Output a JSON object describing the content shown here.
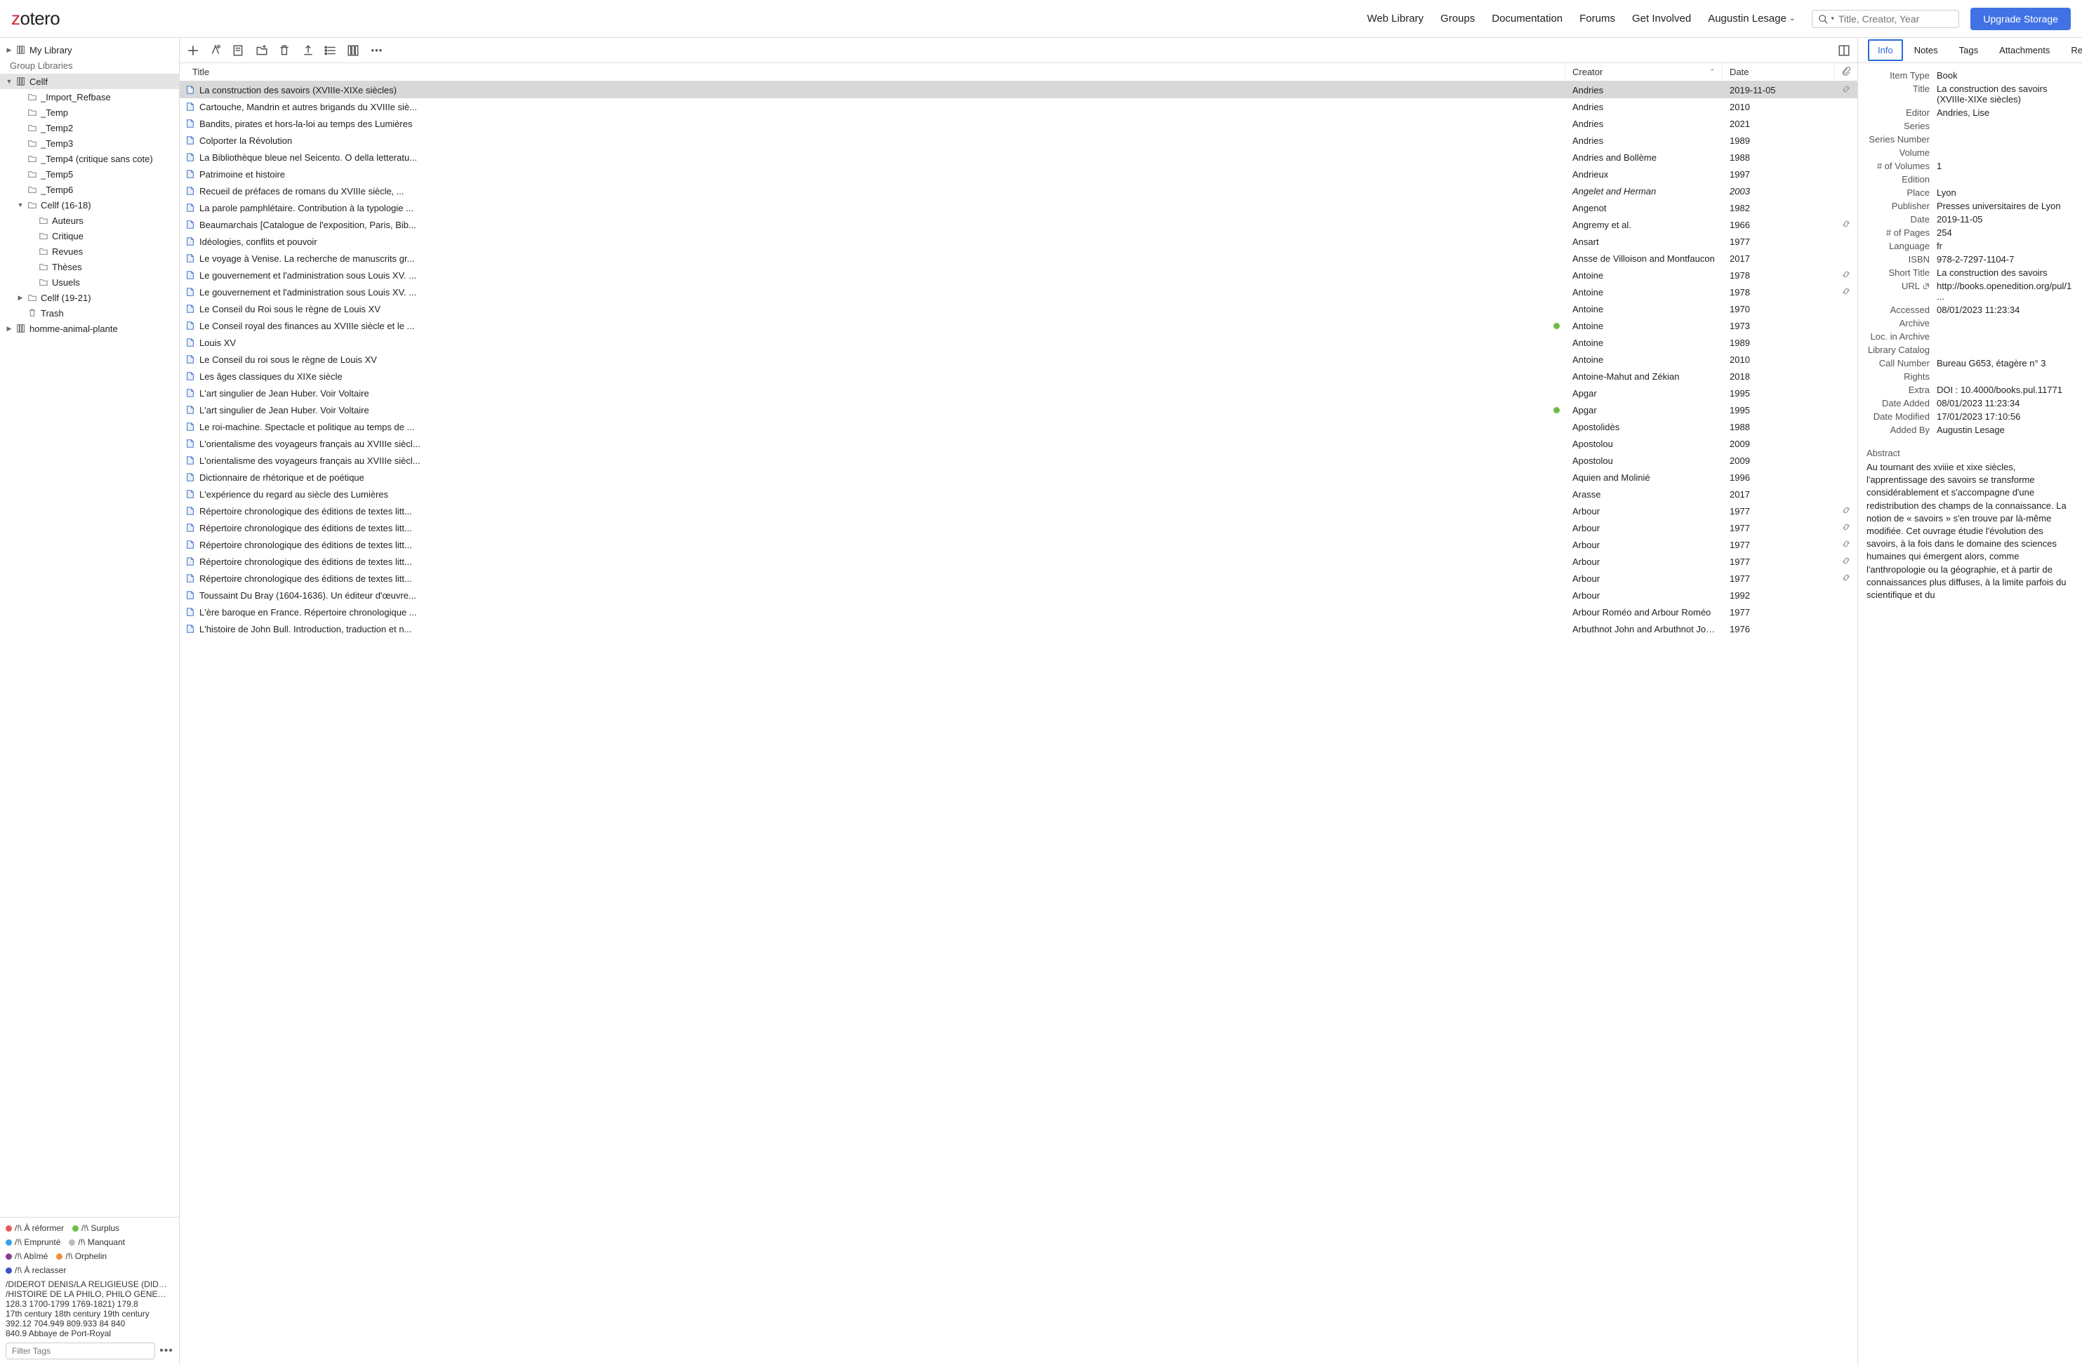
{
  "header": {
    "logo_z": "z",
    "logo_rest": "otero",
    "nav": [
      "Web Library",
      "Groups",
      "Documentation",
      "Forums",
      "Get Involved"
    ],
    "user": "Augustin Lesage",
    "search_placeholder": "Title, Creator, Year",
    "upgrade": "Upgrade Storage"
  },
  "sidebar": {
    "my_library": "My Library",
    "group_header": "Group Libraries",
    "groups": [
      {
        "label": "Cellf",
        "selected": true,
        "children": [
          {
            "label": "_Import_Refbase"
          },
          {
            "label": "_Temp"
          },
          {
            "label": "_Temp2"
          },
          {
            "label": "_Temp3"
          },
          {
            "label": "_Temp4 (critique sans cote)"
          },
          {
            "label": "_Temp5"
          },
          {
            "label": "_Temp6"
          },
          {
            "label": "Cellf (16-18)",
            "expandable": true,
            "open": true,
            "children": [
              {
                "label": "Auteurs"
              },
              {
                "label": "Critique"
              },
              {
                "label": "Revues"
              },
              {
                "label": "Thèses"
              },
              {
                "label": "Usuels"
              }
            ]
          },
          {
            "label": "Cellf (19-21)",
            "expandable": true,
            "open": false
          },
          {
            "label": "Trash",
            "trash": true
          }
        ]
      },
      {
        "label": "homme-animal-plante",
        "expandable": true,
        "open": false
      }
    ]
  },
  "tags": {
    "colored": [
      {
        "color": "#e85a5a",
        "label": "/!\\ À réformer"
      },
      {
        "color": "#6dbd45",
        "label": "/!\\ Surplus"
      },
      {
        "color": "#3aa0e8",
        "label": "/!\\ Emprunté"
      },
      {
        "color": "#bbbbbb",
        "label": "/!\\ Manquant"
      },
      {
        "color": "#8a3c8f",
        "label": "/!\\ Abîmé"
      },
      {
        "color": "#e8923a",
        "label": "/!\\ Orphelin"
      },
      {
        "color": "#3c50c9",
        "label": "/!\\ À reclasser"
      }
    ],
    "plain": [
      "/DIDEROT DENIS/LA RELIGIEUSE (DIDERO...",
      "/HISTOIRE DE LA PHILO, PHILO GENERAL...",
      "128.3   1700-1799   1769-1821)   179.8",
      "17th century   18th century   19th century",
      "392.12   704.949   809.933 84   840",
      "840.9   Abbaye de Port-Royal"
    ],
    "filter_placeholder": "Filter Tags"
  },
  "columns": {
    "title": "Title",
    "creator": "Creator",
    "date": "Date"
  },
  "items": [
    {
      "title": "La construction des savoirs (XVIIIe-XIXe siècles)",
      "creator": "Andries",
      "date": "2019-11-05",
      "attach": true,
      "selected": true
    },
    {
      "title": "Cartouche, Mandrin et autres brigands du XVIIIe siè...",
      "creator": "Andries",
      "date": "2010"
    },
    {
      "title": "Bandits, pirates et hors-la-loi au temps des Lumières",
      "creator": "Andries",
      "date": "2021"
    },
    {
      "title": "Colporter la Révolution",
      "creator": "Andries",
      "date": "1989"
    },
    {
      "title": "La Bibliothèque bleue nel Seicento. O della letteratu...",
      "creator": "Andries and Bollème",
      "date": "1988"
    },
    {
      "title": "Patrimoine et histoire",
      "creator": "Andrieux",
      "date": "1997"
    },
    {
      "title": "Recueil de préfaces de romans du XVIIIe siècle<i>, ...",
      "creator": "Angelet and Herman",
      "date": "2003"
    },
    {
      "title": "La parole pamphlétaire. Contribution à la typologie ...",
      "creator": "Angenot",
      "date": "1982"
    },
    {
      "title": "Beaumarchais [Catalogue de l'exposition, Paris, Bib...",
      "creator": "Angremy et al.",
      "date": "1966",
      "attach": true
    },
    {
      "title": "Idéologies, conflits et pouvoir",
      "creator": "Ansart",
      "date": "1977"
    },
    {
      "title": "Le voyage à Venise. La recherche de manuscrits gr...",
      "creator": "Ansse de Villoison and Montfaucon",
      "date": "2017"
    },
    {
      "title": "Le gouvernement et l'administration sous Louis XV. ...",
      "creator": "Antoine",
      "date": "1978",
      "attach": true
    },
    {
      "title": "Le gouvernement et l'administration sous Louis XV. ...",
      "creator": "Antoine",
      "date": "1978",
      "attach": true
    },
    {
      "title": "Le Conseil du Roi sous le règne de Louis XV",
      "creator": "Antoine",
      "date": "1970"
    },
    {
      "title": "Le Conseil royal des finances au XVIIIe siècle et le ...",
      "creator": "Antoine",
      "date": "1973",
      "dot": "#6dbd45"
    },
    {
      "title": "Louis XV",
      "creator": "Antoine",
      "date": "1989"
    },
    {
      "title": "Le Conseil du roi sous le règne de Louis XV",
      "creator": "Antoine",
      "date": "2010"
    },
    {
      "title": "Les âges classiques du XIXe siècle",
      "creator": "Antoine-Mahut and Zékian",
      "date": "2018"
    },
    {
      "title": "L'art singulier de Jean Huber. Voir Voltaire",
      "creator": "Apgar",
      "date": "1995"
    },
    {
      "title": "L'art singulier de Jean Huber. Voir Voltaire",
      "creator": "Apgar",
      "date": "1995",
      "dot": "#6dbd45"
    },
    {
      "title": "Le roi-machine. Spectacle et politique au temps de ...",
      "creator": "Apostolidès",
      "date": "1988"
    },
    {
      "title": "L'orientalisme des voyageurs français au XVIIIe siècl...",
      "creator": "Apostolou",
      "date": "2009"
    },
    {
      "title": "L'orientalisme des voyageurs français au XVIIIe siècl...",
      "creator": "Apostolou",
      "date": "2009"
    },
    {
      "title": "Dictionnaire de rhétorique et de poétique",
      "creator": "Aquien and Molinié",
      "date": "1996"
    },
    {
      "title": "L'expérience du regard au siècle des Lumières",
      "creator": "Arasse",
      "date": "2017"
    },
    {
      "title": "Répertoire chronologique des éditions de textes litt...",
      "creator": "Arbour",
      "date": "1977",
      "attach": true
    },
    {
      "title": "Répertoire chronologique des éditions de textes litt...",
      "creator": "Arbour",
      "date": "1977",
      "attach": true
    },
    {
      "title": "Répertoire chronologique des éditions de textes litt...",
      "creator": "Arbour",
      "date": "1977",
      "attach": true
    },
    {
      "title": "Répertoire chronologique des éditions de textes litt...",
      "creator": "Arbour",
      "date": "1977",
      "attach": true
    },
    {
      "title": "Répertoire chronologique des éditions de textes litt...",
      "creator": "Arbour",
      "date": "1977",
      "attach": true
    },
    {
      "title": "Toussaint Du Bray (1604-1636). Un éditeur d'œuvre...",
      "creator": "Arbour",
      "date": "1992"
    },
    {
      "title": "L'ère baroque en France. Répertoire chronologique ...",
      "creator": "Arbour Roméo and Arbour Roméo",
      "date": "1977"
    },
    {
      "title": "L'histoire de John Bull. Introduction, traduction et n...",
      "creator": "Arbuthnot John and Arbuthnot John",
      "date": "1976"
    }
  ],
  "detail_tabs": [
    "Info",
    "Notes",
    "Tags",
    "Attachments",
    "Related"
  ],
  "meta": [
    {
      "label": "Item Type",
      "value": "Book"
    },
    {
      "label": "Title",
      "value": "La construction des savoirs (XVIIIe-XIXe siècles)"
    },
    {
      "label": "Editor",
      "value": "Andries, Lise"
    },
    {
      "label": "Series",
      "value": ""
    },
    {
      "label": "Series Number",
      "value": ""
    },
    {
      "label": "Volume",
      "value": ""
    },
    {
      "label": "# of Volumes",
      "value": "1"
    },
    {
      "label": "Edition",
      "value": ""
    },
    {
      "label": "Place",
      "value": "Lyon"
    },
    {
      "label": "Publisher",
      "value": "Presses universitaires de Lyon"
    },
    {
      "label": "Date",
      "value": "2019-11-05"
    },
    {
      "label": "# of Pages",
      "value": "254"
    },
    {
      "label": "Language",
      "value": "fr"
    },
    {
      "label": "ISBN",
      "value": "978-2-7297-1104-7"
    },
    {
      "label": "Short Title",
      "value": "La construction des savoirs"
    },
    {
      "label": "URL",
      "value": "http://books.openedition.org/pul/1...",
      "url": true
    },
    {
      "label": "Accessed",
      "value": "08/01/2023 11:23:34"
    },
    {
      "label": "Archive",
      "value": ""
    },
    {
      "label": "Loc. in Archive",
      "value": ""
    },
    {
      "label": "Library Catalog",
      "value": ""
    },
    {
      "label": "Call Number",
      "value": "Bureau G653, étagère n° 3"
    },
    {
      "label": "Rights",
      "value": ""
    },
    {
      "label": "Extra",
      "value": "DOI : 10.4000/books.pul.11771"
    },
    {
      "label": "Date Added",
      "value": "08/01/2023 11:23:34"
    },
    {
      "label": "Date Modified",
      "value": "17/01/2023 17:10:56"
    },
    {
      "label": "Added By",
      "value": "Augustin Lesage"
    }
  ],
  "abstract_label": "Abstract",
  "abstract": "Au tournant des xviiie et xixe siècles, l'apprentissage des savoirs se transforme considérablement et s'accompagne d'une redistribution des champs de la connaissance. La notion de « savoirs » s'en trouve par là-même modifiée. Cet ouvrage étudie l'évolution des savoirs, à la fois dans le domaine des sciences humaines qui émergent alors, comme l'anthropologie ou la géographie, et à partir de connaissances plus diffuses, à la limite parfois du scientifique et du"
}
